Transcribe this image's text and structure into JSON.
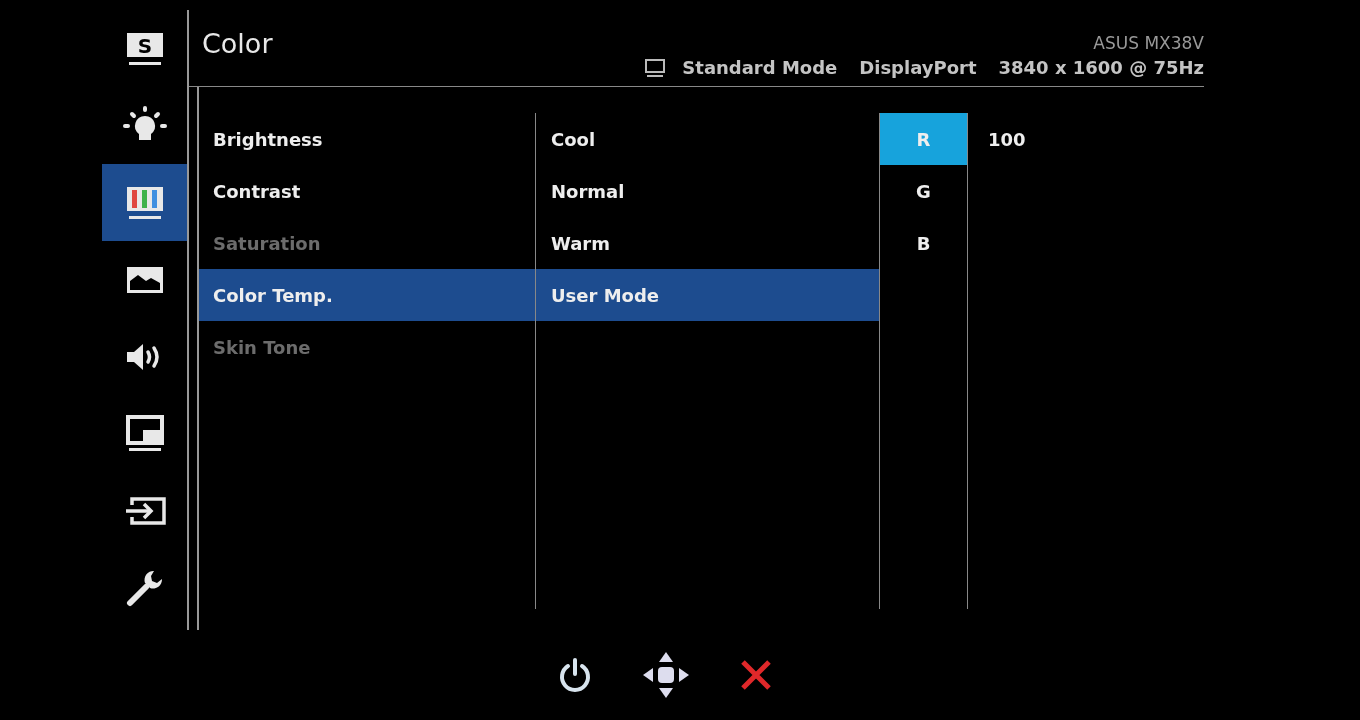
{
  "header": {
    "title": "Color",
    "model": "ASUS MX38V",
    "mode": "Standard Mode",
    "input": "DisplayPort",
    "resolution": "3840 x 1600 @ 75Hz"
  },
  "sidebar": [
    {
      "kind": "splendid",
      "glyph": "S",
      "selected": false
    },
    {
      "kind": "bulb",
      "selected": false
    },
    {
      "kind": "color",
      "selected": true
    },
    {
      "kind": "image",
      "selected": false
    },
    {
      "kind": "sound",
      "selected": false
    },
    {
      "kind": "pip",
      "selected": false
    },
    {
      "kind": "input",
      "selected": false
    },
    {
      "kind": "wrench",
      "selected": false
    }
  ],
  "menu": [
    {
      "label": "Brightness",
      "selected": false,
      "disabled": false
    },
    {
      "label": "Contrast",
      "selected": false,
      "disabled": false
    },
    {
      "label": "Saturation",
      "selected": false,
      "disabled": true
    },
    {
      "label": "Color Temp.",
      "selected": true,
      "disabled": false
    },
    {
      "label": "Skin Tone",
      "selected": false,
      "disabled": true
    }
  ],
  "submenu": [
    {
      "label": "Cool",
      "selected": false
    },
    {
      "label": "Normal",
      "selected": false
    },
    {
      "label": "Warm",
      "selected": false
    },
    {
      "label": "User Mode",
      "selected": true
    }
  ],
  "channels": [
    {
      "label": "R",
      "selected": true
    },
    {
      "label": "G",
      "selected": false
    },
    {
      "label": "B",
      "selected": false
    }
  ],
  "value": "100",
  "footer": [
    {
      "kind": "power"
    },
    {
      "kind": "navigate"
    },
    {
      "kind": "close"
    }
  ]
}
